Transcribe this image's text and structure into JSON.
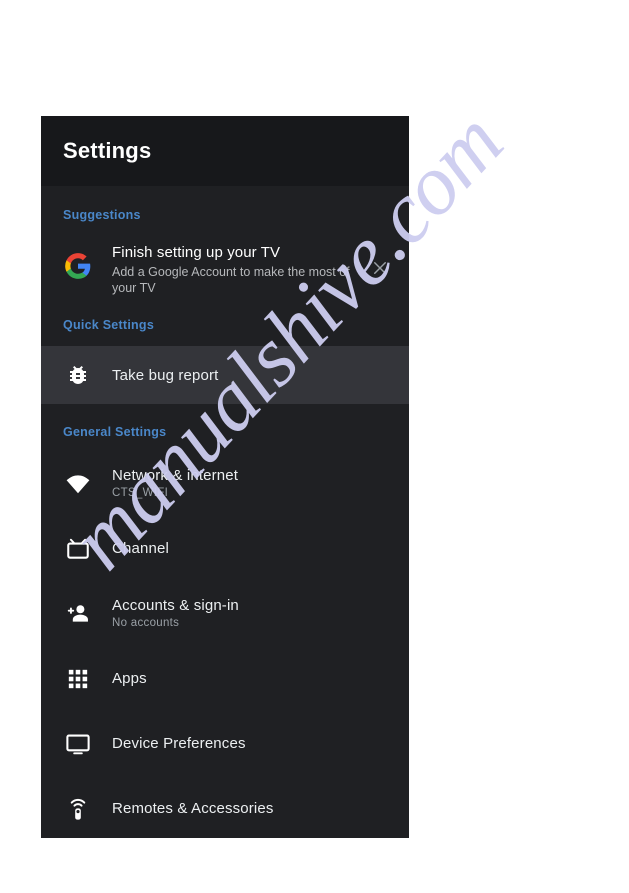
{
  "panel": {
    "header": {
      "title": "Settings"
    },
    "sections": [
      {
        "label": "Suggestions",
        "type": "suggestion",
        "card": {
          "icon": "google-logo-icon",
          "title": "Finish setting up your TV",
          "subtitle": "Add a Google Account to make the most of your TV",
          "dismiss_icon": "close-icon"
        }
      },
      {
        "label": "Quick Settings",
        "type": "list",
        "items": [
          {
            "icon": "bug-icon",
            "label": "Take bug report",
            "sublabel": "",
            "selected": true
          }
        ]
      },
      {
        "label": "General Settings",
        "type": "list",
        "items": [
          {
            "icon": "wifi-icon",
            "label": "Network & internet",
            "sublabel": "CTS_WIFI",
            "selected": false
          },
          {
            "icon": "tv-icon",
            "label": "Channel",
            "sublabel": "",
            "selected": false
          },
          {
            "icon": "person-add-icon",
            "label": "Accounts & sign-in",
            "sublabel": "No accounts",
            "selected": false
          },
          {
            "icon": "apps-grid-icon",
            "label": "Apps",
            "sublabel": "",
            "selected": false
          },
          {
            "icon": "monitor-icon",
            "label": "Device Preferences",
            "sublabel": "",
            "selected": false
          },
          {
            "icon": "remote-icon",
            "label": "Remotes & Accessories",
            "sublabel": "",
            "selected": false
          }
        ]
      }
    ]
  },
  "watermark": {
    "text": "manualshive.com"
  },
  "colors": {
    "page_background": "#ffffff",
    "panel_background": "#1f2023",
    "header_background": "#17181b",
    "section_label": "#4a87c9",
    "selected_row": "#34353a",
    "primary_text": "#eceff1",
    "secondary_text": "#9aa0a6",
    "watermark": "#cdcdf0",
    "google_blue": "#4285F4",
    "google_red": "#EA4335",
    "google_yellow": "#FBBC05",
    "google_green": "#34A853"
  }
}
